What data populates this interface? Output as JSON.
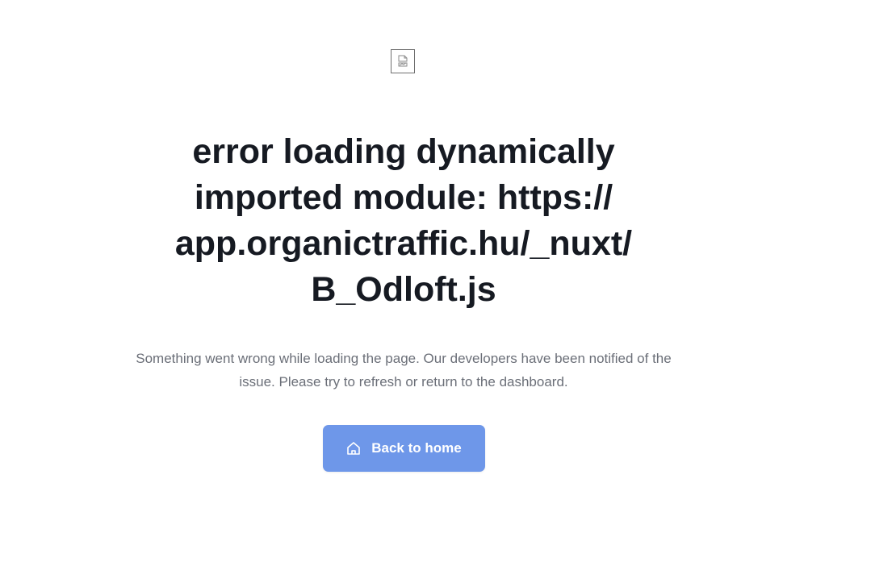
{
  "broken_image": {
    "icon": "broken-image-icon"
  },
  "error": {
    "title": "error loading dynamically imported module: https:// app.organictraffic.hu/_nuxt/ B_Odloft.js",
    "message": "Something went wrong while loading the page. Our developers have been notified of the issue. Please try to refresh or return to the dashboard."
  },
  "actions": {
    "back_label": "Back to home",
    "back_icon": "home-icon"
  },
  "colors": {
    "button_bg": "#6e97e9",
    "title_text": "#161a22",
    "message_text": "#6b6f78"
  }
}
